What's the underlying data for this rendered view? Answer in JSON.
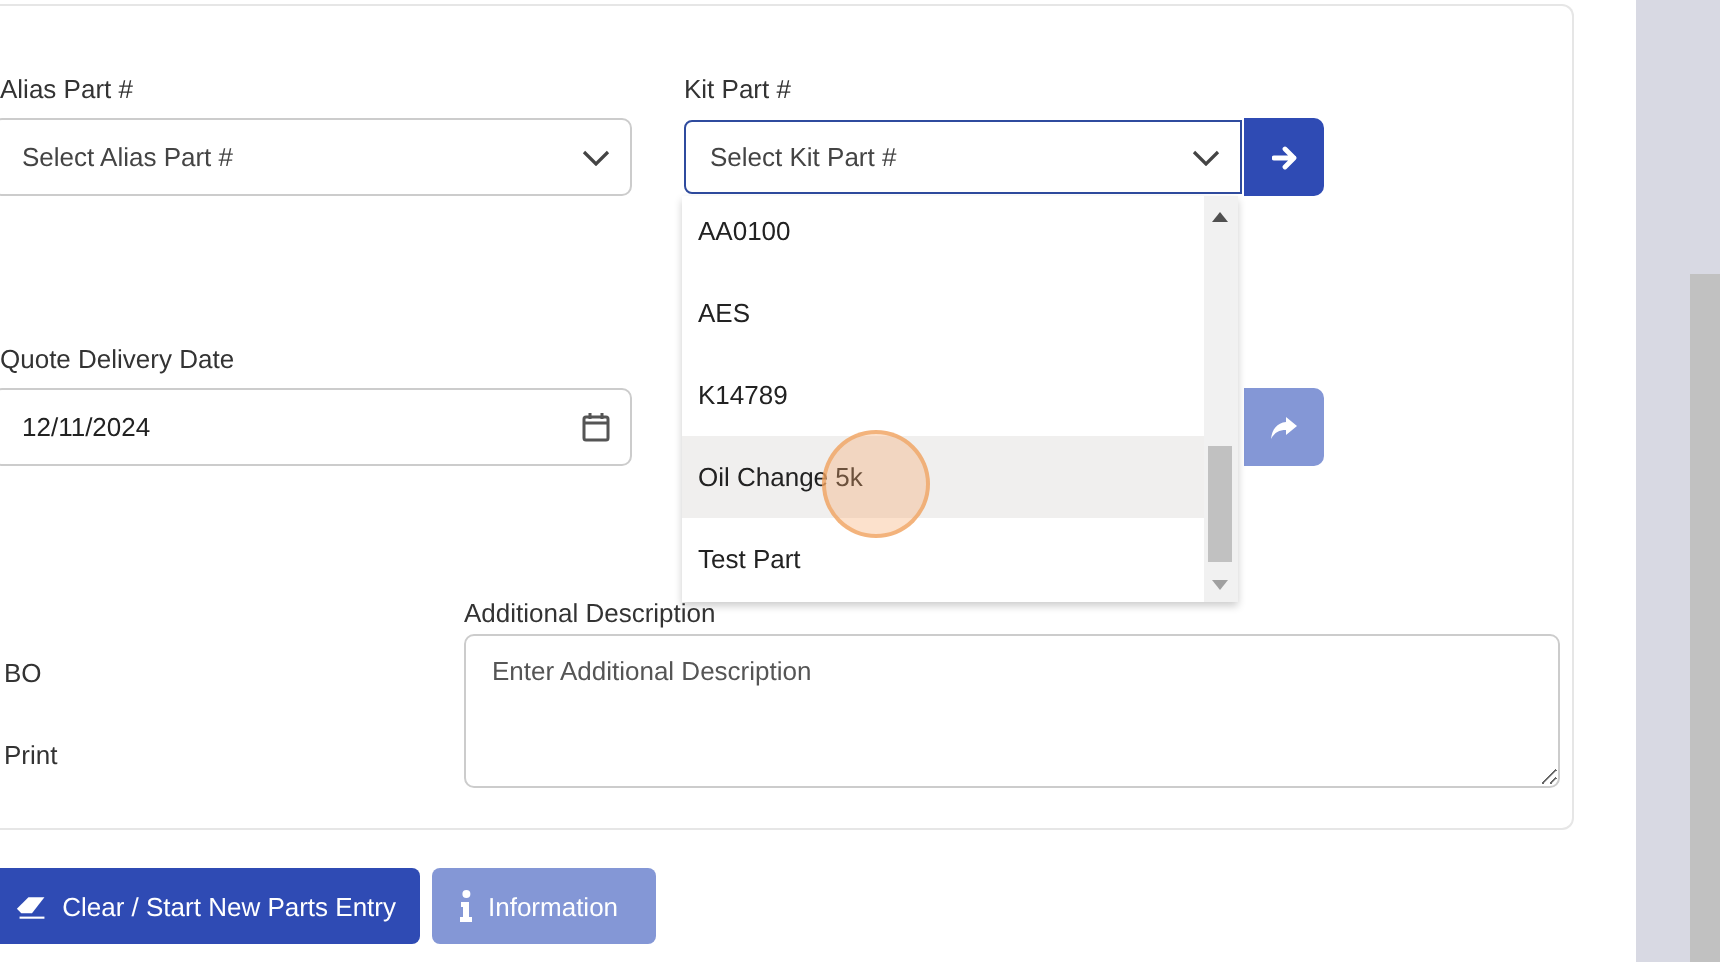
{
  "alias": {
    "label": "Alias Part #",
    "placeholder": "Select Alias Part #"
  },
  "kit": {
    "label": "Kit Part #",
    "placeholder": "Select Kit Part #",
    "expanded": true,
    "options": [
      {
        "label": "AA0100",
        "selected": false
      },
      {
        "label": "AES",
        "selected": false
      },
      {
        "label": "K14789",
        "selected": false
      },
      {
        "label": "Oil Change 5k",
        "selected": true
      },
      {
        "label": "Test Part",
        "selected": false
      }
    ]
  },
  "delivery_date": {
    "label": "Quote Delivery Date",
    "value": "12/11/2024"
  },
  "share_button": {
    "disabled": true
  },
  "options": [
    {
      "label": "BO"
    },
    {
      "label": "Print"
    }
  ],
  "additional_description": {
    "label": "Additional Description",
    "placeholder": "Enter Additional Description"
  },
  "buttons": [
    {
      "label": "Clear / Start New Parts Entry",
      "kind": "clear"
    },
    {
      "label": "Information",
      "kind": "info"
    }
  ]
}
